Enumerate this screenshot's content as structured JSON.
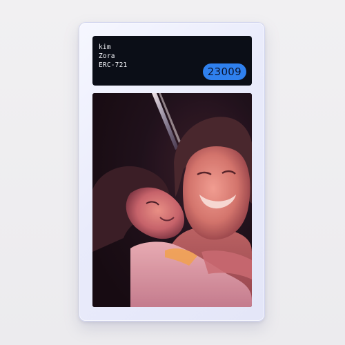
{
  "card": {
    "label": {
      "line1": "kim",
      "line2": "Zora",
      "line3": "ERC-721"
    },
    "badge": "23009",
    "photo": {
      "subject": "selfie-photo",
      "colors": {
        "background": "#05060c",
        "light_streak": "#e8f0ff",
        "skin_warm": "#d27a6a",
        "shirt": "#d9a0a8",
        "accent": "#f0a84a"
      }
    }
  },
  "colors": {
    "page_background": "#efeef1",
    "slab": "#eceefb",
    "label_background": "#0b0e17",
    "label_text": "#f2f3f8",
    "badge": "#2f80ee"
  }
}
